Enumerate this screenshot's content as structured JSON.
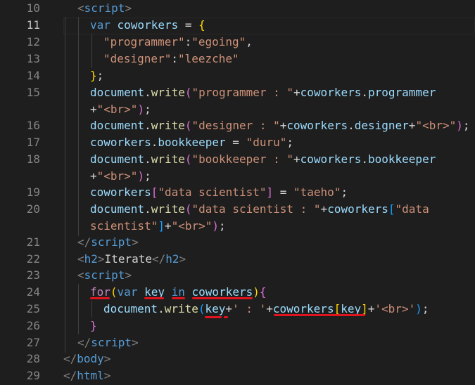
{
  "editor": {
    "active_line": "11",
    "lines": [
      {
        "num": "10",
        "tokens": [
          [
            "t-punc",
            "<"
          ],
          [
            "t-tag",
            "script"
          ],
          [
            "t-punc",
            ">"
          ]
        ]
      },
      {
        "num": "11",
        "tokens": [
          [
            "t-kw",
            "var "
          ],
          [
            "t-var",
            "coworkers"
          ],
          [
            "t-plain",
            " = "
          ],
          [
            "t-brk",
            "{"
          ]
        ]
      },
      {
        "num": "12",
        "tokens": [
          [
            "t-str",
            "\"programmer\""
          ],
          [
            "t-plain",
            ":"
          ],
          [
            "t-str",
            "\"egoing\""
          ],
          [
            "t-plain",
            ","
          ]
        ]
      },
      {
        "num": "13",
        "tokens": [
          [
            "t-str",
            "\"designer\""
          ],
          [
            "t-plain",
            ":"
          ],
          [
            "t-str",
            "\"leezche\""
          ]
        ]
      },
      {
        "num": "14",
        "tokens": [
          [
            "t-brk",
            "}"
          ],
          [
            "t-plain",
            ";"
          ]
        ]
      },
      {
        "num": "15",
        "tokens": [
          [
            "t-var",
            "document"
          ],
          [
            "t-plain",
            "."
          ],
          [
            "t-fn",
            "write"
          ],
          [
            "t-brk2",
            "("
          ],
          [
            "t-str",
            "\"programmer : \""
          ],
          [
            "t-plain",
            "+"
          ],
          [
            "t-var",
            "coworkers"
          ],
          [
            "t-plain",
            "."
          ],
          [
            "t-var",
            "programmer"
          ]
        ]
      },
      {
        "num": "",
        "tokens": [
          [
            "t-plain",
            "+"
          ],
          [
            "t-str",
            "\"<br>\""
          ],
          [
            "t-brk2",
            ")"
          ],
          [
            "t-plain",
            ";"
          ]
        ]
      },
      {
        "num": "16",
        "tokens": [
          [
            "t-var",
            "document"
          ],
          [
            "t-plain",
            "."
          ],
          [
            "t-fn",
            "write"
          ],
          [
            "t-brk2",
            "("
          ],
          [
            "t-str",
            "\"designer : \""
          ],
          [
            "t-plain",
            "+"
          ],
          [
            "t-var",
            "coworkers"
          ],
          [
            "t-plain",
            "."
          ],
          [
            "t-var",
            "designer"
          ],
          [
            "t-plain",
            "+"
          ],
          [
            "t-str",
            "\"<br>\""
          ],
          [
            "t-brk2",
            ")"
          ],
          [
            "t-plain",
            ";"
          ]
        ]
      },
      {
        "num": "17",
        "tokens": [
          [
            "t-var",
            "coworkers"
          ],
          [
            "t-plain",
            "."
          ],
          [
            "t-var",
            "bookkeeper"
          ],
          [
            "t-plain",
            " = "
          ],
          [
            "t-str",
            "\"duru\""
          ],
          [
            "t-plain",
            ";"
          ]
        ]
      },
      {
        "num": "18",
        "tokens": [
          [
            "t-var",
            "document"
          ],
          [
            "t-plain",
            "."
          ],
          [
            "t-fn",
            "write"
          ],
          [
            "t-brk2",
            "("
          ],
          [
            "t-str",
            "\"bookkeeper : \""
          ],
          [
            "t-plain",
            "+"
          ],
          [
            "t-var",
            "coworkers"
          ],
          [
            "t-plain",
            "."
          ],
          [
            "t-var",
            "bookkeeper"
          ]
        ]
      },
      {
        "num": "",
        "tokens": [
          [
            "t-plain",
            "+"
          ],
          [
            "t-str",
            "\"<br>\""
          ],
          [
            "t-brk2",
            ")"
          ],
          [
            "t-plain",
            ";"
          ]
        ]
      },
      {
        "num": "19",
        "tokens": [
          [
            "t-var",
            "coworkers"
          ],
          [
            "t-brk2",
            "["
          ],
          [
            "t-str",
            "\"data scientist\""
          ],
          [
            "t-brk2",
            "]"
          ],
          [
            "t-plain",
            " = "
          ],
          [
            "t-str",
            "\"taeho\""
          ],
          [
            "t-plain",
            ";"
          ]
        ]
      },
      {
        "num": "20",
        "tokens": [
          [
            "t-var",
            "document"
          ],
          [
            "t-plain",
            "."
          ],
          [
            "t-fn",
            "write"
          ],
          [
            "t-brk2",
            "("
          ],
          [
            "t-str",
            "\"data scientist : \""
          ],
          [
            "t-plain",
            "+"
          ],
          [
            "t-var",
            "coworkers"
          ],
          [
            "t-brk3",
            "["
          ],
          [
            "t-str",
            "\"data"
          ]
        ]
      },
      {
        "num": "",
        "tokens": [
          [
            "t-str",
            "scientist\""
          ],
          [
            "t-brk3",
            "]"
          ],
          [
            "t-plain",
            "+"
          ],
          [
            "t-str",
            "\"<br>\""
          ],
          [
            "t-brk2",
            ")"
          ],
          [
            "t-plain",
            ";"
          ]
        ]
      },
      {
        "num": "21",
        "tokens": [
          [
            "t-punc",
            "</"
          ],
          [
            "t-tag",
            "script"
          ],
          [
            "t-punc",
            ">"
          ]
        ]
      },
      {
        "num": "22",
        "tokens": [
          [
            "t-punc",
            "<"
          ],
          [
            "t-tag",
            "h2"
          ],
          [
            "t-punc",
            ">"
          ],
          [
            "t-plain",
            "Iterate"
          ],
          [
            "t-punc",
            "</"
          ],
          [
            "t-tag",
            "h2"
          ],
          [
            "t-punc",
            ">"
          ]
        ]
      },
      {
        "num": "23",
        "tokens": [
          [
            "t-punc",
            "<"
          ],
          [
            "t-tag",
            "script"
          ],
          [
            "t-punc",
            ">"
          ]
        ]
      },
      {
        "num": "24",
        "tokens": [
          [
            "t-ctrl",
            "for"
          ],
          [
            "t-brk",
            "("
          ],
          [
            "t-kw",
            "var "
          ],
          [
            "t-var",
            "key"
          ],
          [
            "t-plain",
            " "
          ],
          [
            "t-kw",
            "in"
          ],
          [
            "t-plain",
            " "
          ],
          [
            "t-var",
            "coworkers"
          ],
          [
            "t-brk",
            ")"
          ],
          [
            "t-brk2",
            "{"
          ]
        ]
      },
      {
        "num": "25",
        "tokens": [
          [
            "t-var",
            "document"
          ],
          [
            "t-plain",
            "."
          ],
          [
            "t-fn",
            "write"
          ],
          [
            "t-brk3",
            "("
          ],
          [
            "t-var",
            "key"
          ],
          [
            "t-plain",
            "+"
          ],
          [
            "t-str",
            "' : '"
          ],
          [
            "t-plain",
            "+"
          ],
          [
            "t-var",
            "coworkers"
          ],
          [
            "t-brk",
            "["
          ],
          [
            "t-var",
            "key"
          ],
          [
            "t-brk",
            "]"
          ],
          [
            "t-plain",
            "+"
          ],
          [
            "t-str",
            "'<br>'"
          ],
          [
            "t-brk3",
            ")"
          ],
          [
            "t-plain",
            ";"
          ]
        ]
      },
      {
        "num": "26",
        "tokens": [
          [
            "t-brk2",
            "}"
          ]
        ]
      },
      {
        "num": "27",
        "tokens": [
          [
            "t-punc",
            "</"
          ],
          [
            "t-tag",
            "script"
          ],
          [
            "t-punc",
            ">"
          ]
        ]
      },
      {
        "num": "28",
        "tokens": [
          [
            "t-punc",
            "</"
          ],
          [
            "t-tag",
            "body"
          ],
          [
            "t-punc",
            ">"
          ]
        ]
      },
      {
        "num": "29",
        "tokens": [
          [
            "t-punc",
            "</"
          ],
          [
            "t-tag",
            "html"
          ],
          [
            "t-punc",
            ">"
          ]
        ]
      }
    ]
  }
}
